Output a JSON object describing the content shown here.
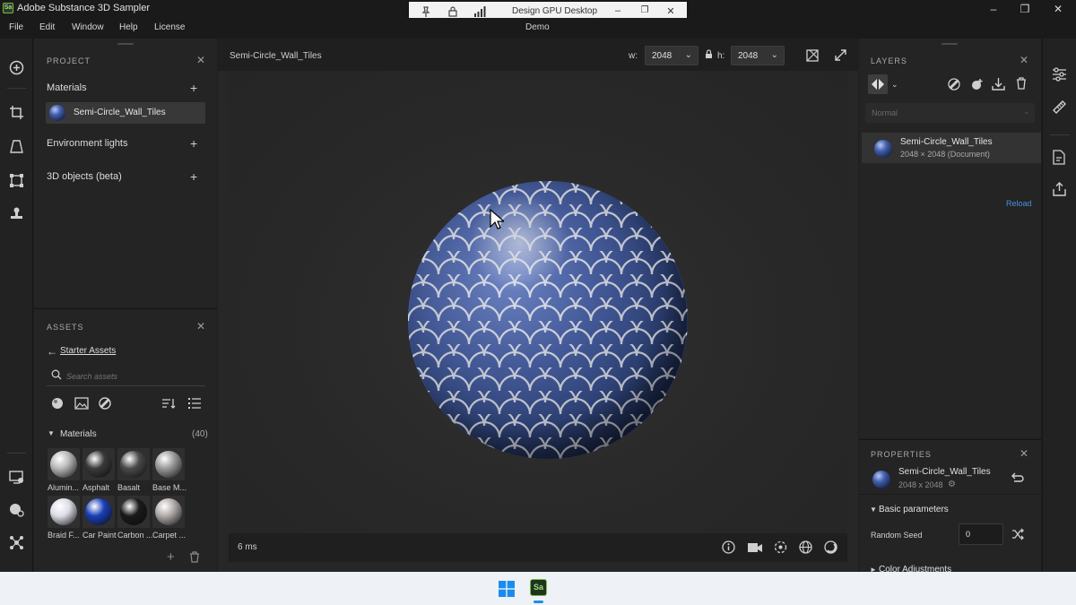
{
  "window": {
    "title": "Adobe Substance 3D Sampler",
    "logo_text": "Sa",
    "document_title": "Demo"
  },
  "remote_bar": {
    "title": "Design GPU Desktop"
  },
  "menu": {
    "items": [
      "File",
      "Edit",
      "Window",
      "Help",
      "License"
    ]
  },
  "project": {
    "header": "PROJECT",
    "materials_label": "Materials",
    "selected_material": "Semi-Circle_Wall_Tiles",
    "environment_label": "Environment lights",
    "objects_label": "3D objects (beta)"
  },
  "assets": {
    "header": "ASSETS",
    "back_label": "Starter Assets",
    "search_placeholder": "Search assets",
    "category_label": "Materials",
    "count": "(40)",
    "items": [
      {
        "label": "Alumin...",
        "color": "#b8b8b8"
      },
      {
        "label": "Asphalt",
        "color": "#3a3a3a"
      },
      {
        "label": "Basalt",
        "color": "#4a4a4a"
      },
      {
        "label": "Base M...",
        "color": "#9a9a9a"
      },
      {
        "label": "Braid F...",
        "color": "#dcdde8"
      },
      {
        "label": "Car Paint",
        "color": "#1a3fb8"
      },
      {
        "label": "Carbon ...",
        "color": "#1a1a1a"
      },
      {
        "label": "Carpet ...",
        "color": "#b0aaa8"
      }
    ]
  },
  "viewport": {
    "tab_label": "Semi-Circle_Wall_Tiles",
    "width_label": "w:",
    "width_value": "2048",
    "height_label": "h:",
    "height_value": "2048",
    "render_time": "6 ms"
  },
  "layers": {
    "header": "LAYERS",
    "blend_mode": "Normal",
    "item_name": "Semi-Circle_Wall_Tiles",
    "item_info": "2048 × 2048 (Document)",
    "reload_label": "Reload"
  },
  "properties": {
    "header": "PROPERTIES",
    "name": "Semi-Circle_Wall_Tiles",
    "size": "2048 x 2048",
    "section_label": "Basic parameters",
    "random_seed_label": "Random Seed",
    "random_seed_value": "0",
    "next_section_label": "Color Adjustments"
  },
  "colors": {
    "accent_link": "#4a8fe0",
    "logo_green": "#7cbd4a"
  }
}
